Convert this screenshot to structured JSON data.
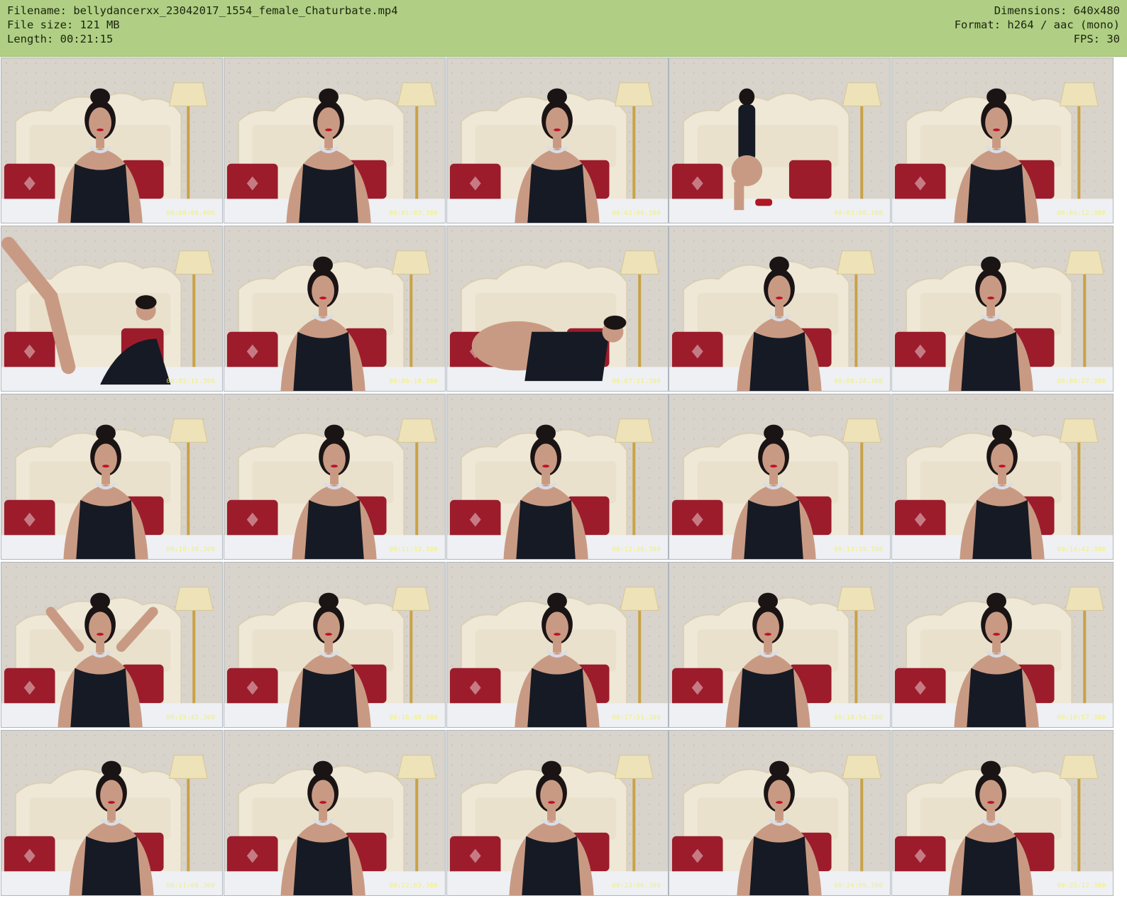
{
  "header": {
    "filename_line": "Filename: bellydancerxx_23042017_1554_female_Chaturbate.mp4",
    "filesize_line": "File size: 121 MB",
    "length_line": "Length: 00:21:15",
    "dimensions_line": "Dimensions: 640x480",
    "format_line": "Format: h264 / aac (mono)",
    "fps_line": "FPS: 30"
  },
  "colors": {
    "header_bg": "#b0cf84",
    "thumb_border": "#aeb6bd",
    "wall": "#d8d3cb",
    "headboard": "#efe8d6",
    "pillow": "#9c1c2c",
    "bed": "#eef0f4",
    "lamp_shade": "#eee2b8",
    "timestamp": "#f3ef62"
  },
  "thumbnails": [
    {
      "timestamp": "00:00:00.000",
      "pose": "lean-forward"
    },
    {
      "timestamp": "00:01:03.300",
      "pose": "sit-front"
    },
    {
      "timestamp": "00:02:06.300",
      "pose": "sit-front"
    },
    {
      "timestamp": "00:03:09.300",
      "pose": "kneel-back"
    },
    {
      "timestamp": "00:04:12.300",
      "pose": "sit-front"
    },
    {
      "timestamp": "00:05:15.300",
      "pose": "legs-up"
    },
    {
      "timestamp": "00:06:18.300",
      "pose": "sit-front"
    },
    {
      "timestamp": "00:07:21.300",
      "pose": "lie-side"
    },
    {
      "timestamp": "00:08:24.300",
      "pose": "sit-front"
    },
    {
      "timestamp": "00:09:27.300",
      "pose": "sit-front"
    },
    {
      "timestamp": "00:10:30.300",
      "pose": "sit-front"
    },
    {
      "timestamp": "00:11:33.300",
      "pose": "sit-front"
    },
    {
      "timestamp": "00:12:36.300",
      "pose": "sit-front"
    },
    {
      "timestamp": "00:13:39.300",
      "pose": "sit-front"
    },
    {
      "timestamp": "00:14:42.300",
      "pose": "sit-front"
    },
    {
      "timestamp": "00:15:45.300",
      "pose": "wave"
    },
    {
      "timestamp": "00:16:48.300",
      "pose": "sit-front"
    },
    {
      "timestamp": "00:17:51.300",
      "pose": "sit-front"
    },
    {
      "timestamp": "00:18:54.300",
      "pose": "sit-front"
    },
    {
      "timestamp": "00:19:57.300",
      "pose": "sit-front"
    },
    {
      "timestamp": "00:21:00.300",
      "pose": "sit-front"
    },
    {
      "timestamp": "00:22:03.300",
      "pose": "sit-front"
    },
    {
      "timestamp": "00:23:06.300",
      "pose": "sit-front"
    },
    {
      "timestamp": "00:24:09.300",
      "pose": "sit-front"
    },
    {
      "timestamp": "00:25:12.300",
      "pose": "sit-front"
    }
  ]
}
